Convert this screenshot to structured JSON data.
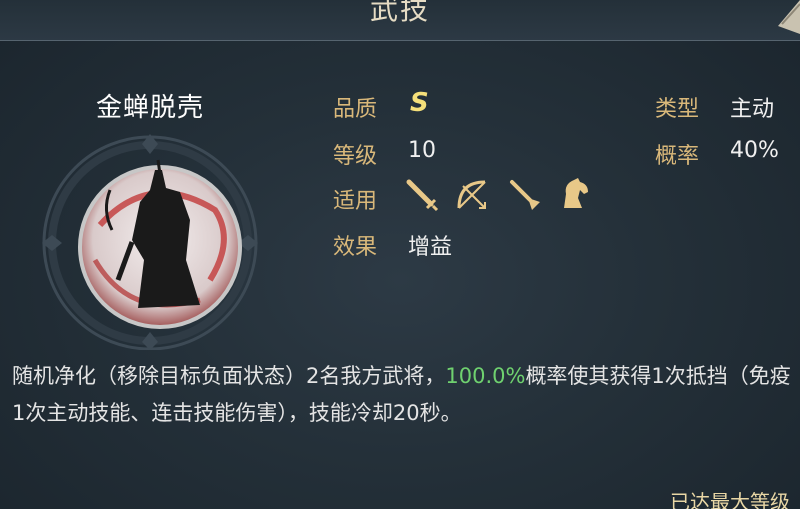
{
  "header": {
    "title": "武技"
  },
  "skill": {
    "name": "金蝉脱壳",
    "attributes": {
      "quality_label": "品质",
      "quality_value": "S",
      "level_label": "等级",
      "level_value": "10",
      "applies_label": "适用",
      "effect_label": "效果",
      "effect_value": "增益",
      "type_label": "类型",
      "type_value": "主动",
      "chance_label": "概率",
      "chance_value": "40%"
    },
    "applies_icons": [
      "sword-icon",
      "bow-icon",
      "spear-icon",
      "horse-icon"
    ],
    "description": {
      "part1": "随机净化（移除目标负面状态）2名我方武将，",
      "highlight": "100.0%",
      "part2": "概率使其获得1次抵挡（免疫1次主动技能、连击技能伤害），技能冷却20秒。"
    }
  },
  "footer": {
    "max_level_text": "已达最大等级"
  },
  "colors": {
    "label": "#d9b87a",
    "value": "#f0f0f0",
    "quality": "#f5e07a",
    "highlight": "#6fd16f",
    "background": "#242f38"
  }
}
